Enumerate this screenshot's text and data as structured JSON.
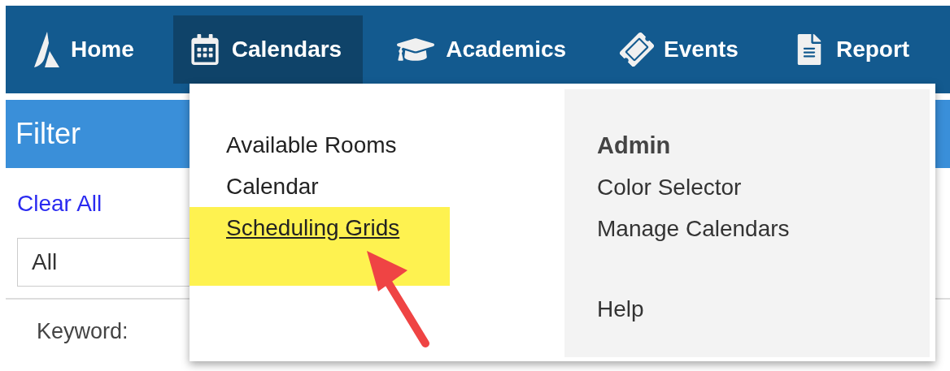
{
  "nav": {
    "items": [
      {
        "label": "Home",
        "selected": false
      },
      {
        "label": "Calendars",
        "selected": true
      },
      {
        "label": "Academics",
        "selected": false
      },
      {
        "label": "Events",
        "selected": false
      },
      {
        "label": "Report",
        "selected": false
      }
    ]
  },
  "filter": {
    "title": "Filter",
    "clear_link": "Clear All",
    "select_value": "All",
    "keyword_label": "Keyword:"
  },
  "dropdown": {
    "left_items": [
      {
        "label": "Available Rooms",
        "hovered": false,
        "highlighted": false
      },
      {
        "label": "Calendar",
        "hovered": false,
        "highlighted": false
      },
      {
        "label": "Scheduling Grids",
        "hovered": true,
        "highlighted": true
      }
    ],
    "right_groups": [
      {
        "heading": "Admin",
        "items": [
          {
            "label": "Color Selector"
          },
          {
            "label": "Manage Calendars"
          }
        ]
      },
      {
        "items": [
          {
            "label": "Help"
          }
        ]
      }
    ]
  }
}
